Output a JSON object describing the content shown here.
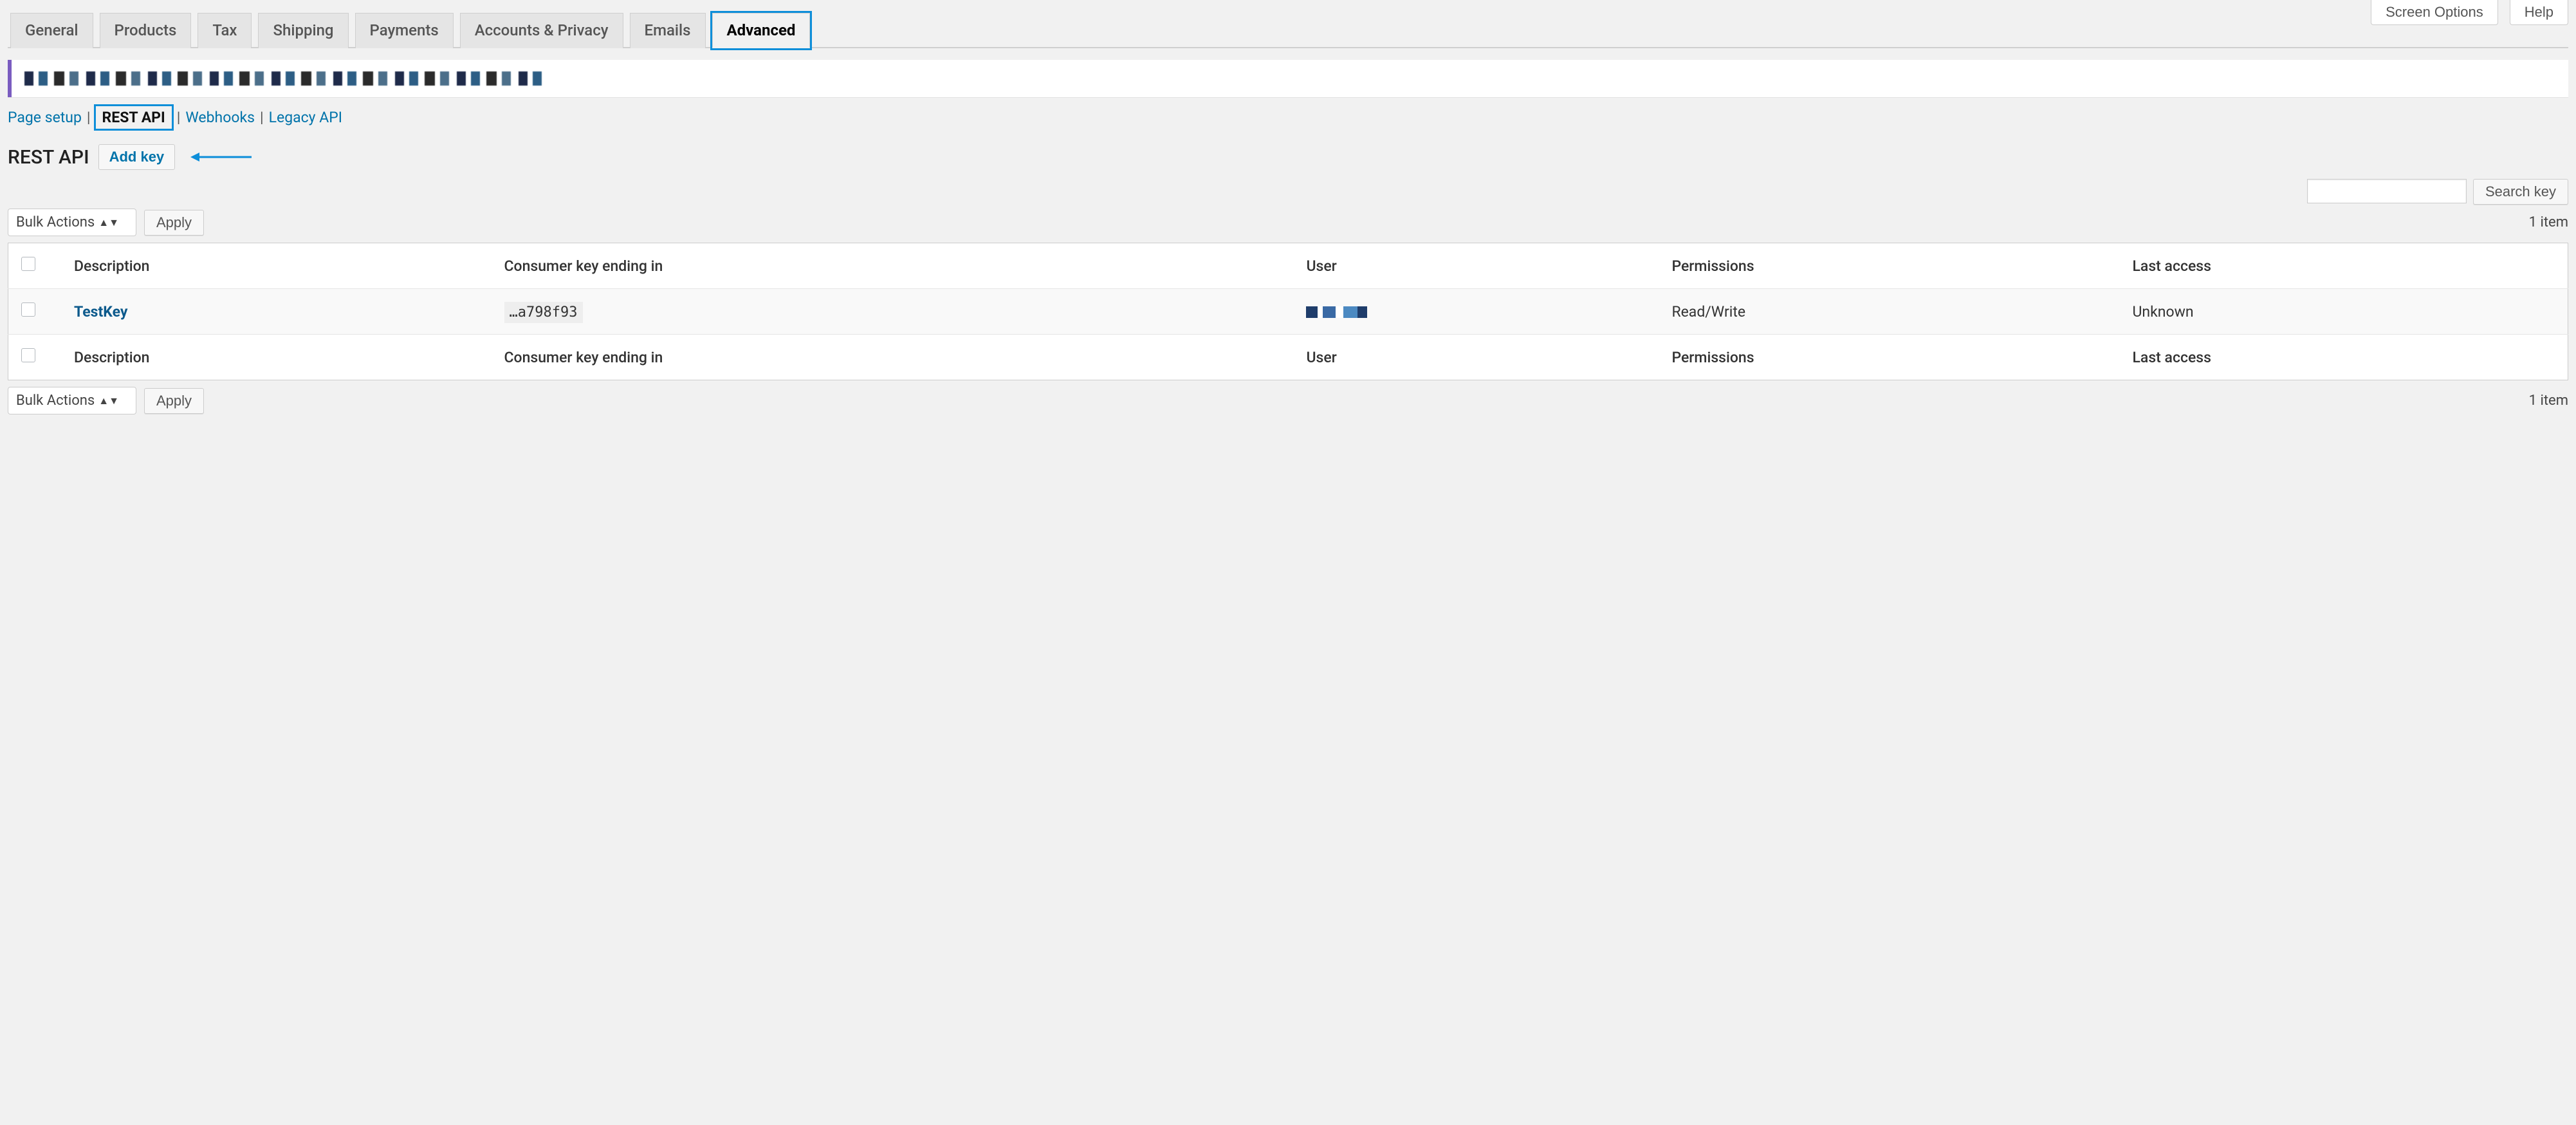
{
  "top_buttons": {
    "screen_options": "Screen Options",
    "help": "Help"
  },
  "tabs": [
    {
      "label": "General",
      "active": false
    },
    {
      "label": "Products",
      "active": false
    },
    {
      "label": "Tax",
      "active": false
    },
    {
      "label": "Shipping",
      "active": false
    },
    {
      "label": "Payments",
      "active": false
    },
    {
      "label": "Accounts & Privacy",
      "active": false
    },
    {
      "label": "Emails",
      "active": false
    },
    {
      "label": "Advanced",
      "active": true,
      "highlight": true
    }
  ],
  "sub_tabs": {
    "page_setup": "Page setup",
    "rest_api": "REST API",
    "webhooks": "Webhooks",
    "legacy_api": "Legacy API"
  },
  "heading": "REST API",
  "add_key_label": "Add key",
  "search": {
    "value": "",
    "button": "Search key"
  },
  "bulk_actions": {
    "label": "Bulk Actions",
    "apply": "Apply"
  },
  "item_count_text": "1 item",
  "columns": {
    "description": "Description",
    "consumer_key": "Consumer key ending in",
    "user": "User",
    "permissions": "Permissions",
    "last_access": "Last access"
  },
  "rows": [
    {
      "description": "TestKey",
      "key_ending": "…a798f93",
      "user": "(redacted)",
      "permissions": "Read/Write",
      "last_access": "Unknown"
    }
  ],
  "highlight_color": "#0d8ed9"
}
